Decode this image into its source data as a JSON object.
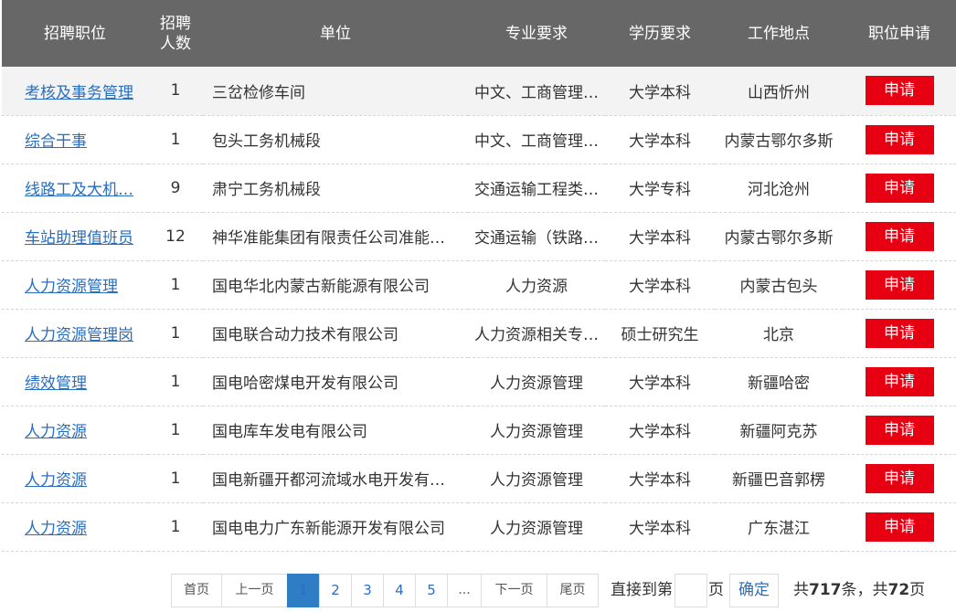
{
  "table": {
    "headers": {
      "title": "招聘职位",
      "count_line1": "招聘",
      "count_line2": "人数",
      "unit": "单位",
      "major": "专业要求",
      "education": "学历要求",
      "location": "工作地点",
      "apply": "职位申请"
    },
    "apply_label": "申请",
    "rows": [
      {
        "title": "考核及事务管理",
        "count": "1",
        "unit": "三岔检修车间",
        "major": "中文、工商管理…",
        "education": "大学本科",
        "location": "山西忻州"
      },
      {
        "title": "综合干事",
        "count": "1",
        "unit": "包头工务机械段",
        "major": "中文、工商管理…",
        "education": "大学本科",
        "location": "内蒙古鄂尔多斯"
      },
      {
        "title": "线路工及大机…",
        "count": "9",
        "unit": "肃宁工务机械段",
        "major": "交通运输工程类…",
        "education": "大学专科",
        "location": "河北沧州"
      },
      {
        "title": "车站助理值班员",
        "count": "12",
        "unit": "神华准能集团有限责任公司准能…",
        "major": "交通运输（铁路…",
        "education": "大学本科",
        "location": "内蒙古鄂尔多斯"
      },
      {
        "title": "人力资源管理",
        "count": "1",
        "unit": "国电华北内蒙古新能源有限公司",
        "major": "人力资源",
        "education": "大学本科",
        "location": "内蒙古包头"
      },
      {
        "title": "人力资源管理岗",
        "count": "1",
        "unit": "国电联合动力技术有限公司",
        "major": "人力资源相关专…",
        "education": "硕士研究生",
        "location": "北京"
      },
      {
        "title": "绩效管理",
        "count": "1",
        "unit": "国电哈密煤电开发有限公司",
        "major": "人力资源管理",
        "education": "大学本科",
        "location": "新疆哈密"
      },
      {
        "title": "人力资源",
        "count": "1",
        "unit": "国电库车发电有限公司",
        "major": "人力资源管理",
        "education": "大学本科",
        "location": "新疆阿克苏"
      },
      {
        "title": "人力资源",
        "count": "1",
        "unit": "国电新疆开都河流域水电开发有…",
        "major": "人力资源管理",
        "education": "大学本科",
        "location": "新疆巴音郭楞"
      },
      {
        "title": "人力资源",
        "count": "1",
        "unit": "国电电力广东新能源开发有限公司",
        "major": "人力资源管理",
        "education": "大学本科",
        "location": "广东湛江"
      }
    ]
  },
  "pagination": {
    "first": "首页",
    "prev": "上一页",
    "pages": [
      "1",
      "2",
      "3",
      "4",
      "5"
    ],
    "ellipsis": "...",
    "next": "下一页",
    "last": "尾页",
    "goto_prefix": "直接到第",
    "goto_suffix": "页",
    "goto_value": "",
    "confirm": "确定",
    "total_prefix": "共",
    "total_count": "717",
    "total_mid": "条，共",
    "total_pages": "72",
    "total_suffix": "页"
  },
  "colors": {
    "header_bg": "#676767",
    "apply_button": "#e60012",
    "link": "#2a6ebf",
    "active_page": "#2f7ec5"
  }
}
